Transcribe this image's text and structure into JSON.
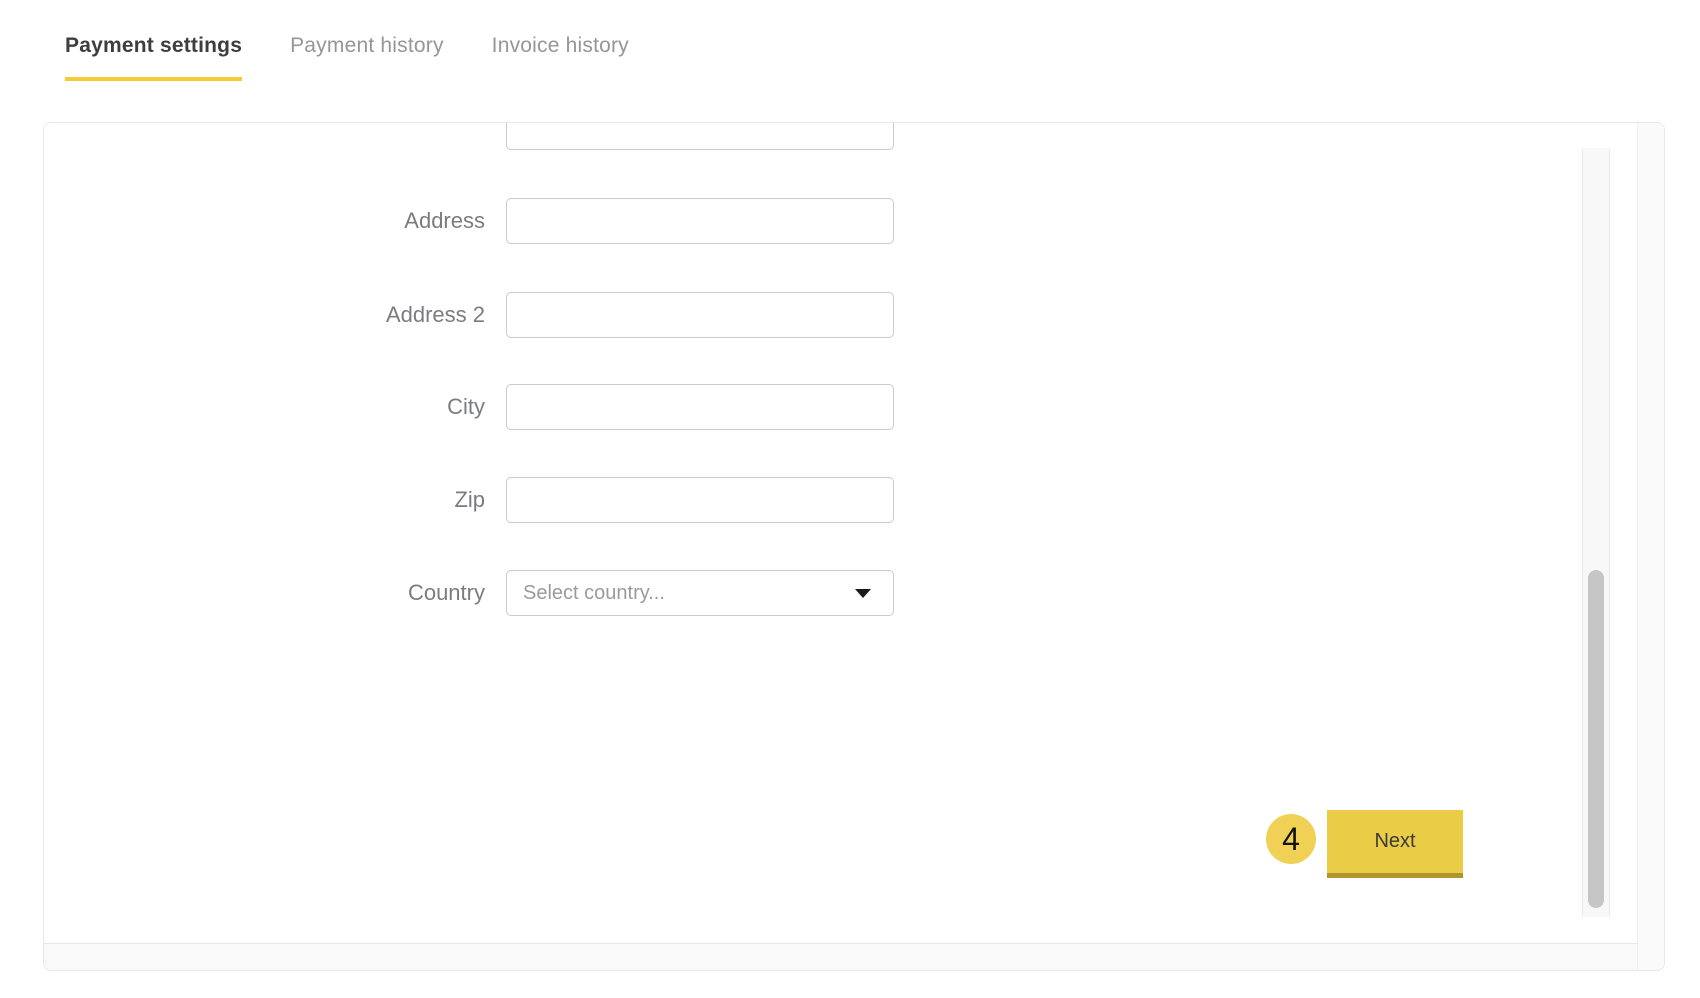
{
  "tabs": {
    "items": [
      {
        "label": "Payment settings",
        "active": true
      },
      {
        "label": "Payment history",
        "active": false
      },
      {
        "label": "Invoice history",
        "active": false
      }
    ]
  },
  "form": {
    "fields": [
      {
        "label": "Address",
        "value": ""
      },
      {
        "label": "Address 2",
        "value": ""
      },
      {
        "label": "City",
        "value": ""
      },
      {
        "label": "Zip",
        "value": ""
      }
    ],
    "country": {
      "label": "Country",
      "placeholder": "Select country...",
      "selected_value": ""
    },
    "partial_field_value": ""
  },
  "actions": {
    "step_badge": "4",
    "next_label": "Next"
  },
  "colors": {
    "tab_active_underline": "#f5cb36",
    "tab_active_text": "#3d3e40",
    "tab_inactive_text": "#95969a",
    "badge_yellow": "#f0d155",
    "button_yellow": "#ebcc47",
    "button_bottom_edge": "#b0942e",
    "input_border": "#c9cbd4",
    "label_gray": "#7b7c7f",
    "scroll_thumb": "#c6c6c6"
  }
}
